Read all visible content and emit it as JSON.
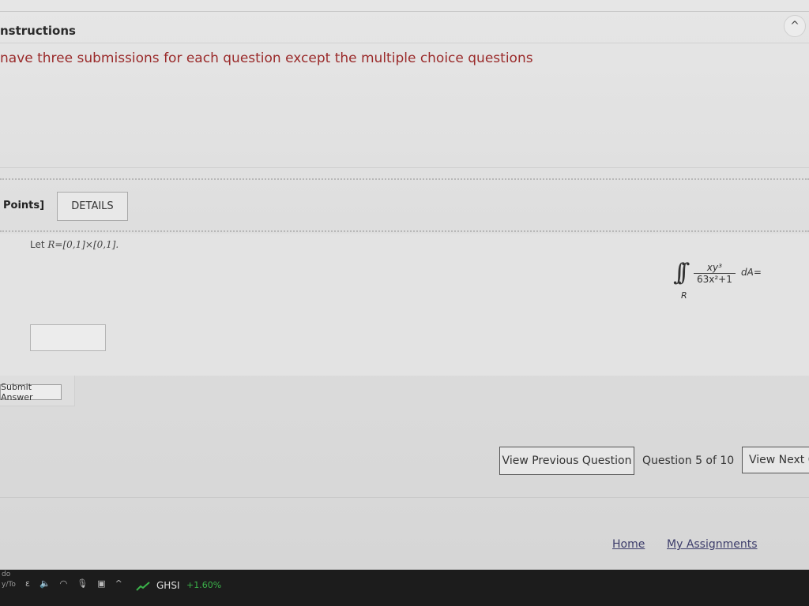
{
  "instructions": {
    "title": "nstructions",
    "text": "nave three submissions for each question except the multiple choice questions"
  },
  "header_buttons": {
    "collapse_glyph": "^"
  },
  "question": {
    "points_label": "Points]",
    "details_label": "DETAILS",
    "let_prefix": "Let ",
    "region_def": "R=[0,1]×[0,1].",
    "integral_sign": "∫∫",
    "numerator": "xy³",
    "denominator": "63x²+1",
    "differential": "dA=",
    "region_label": "R",
    "answer_value": "",
    "submit_label": "Submit Answer"
  },
  "navigation": {
    "prev_label": "View Previous Question",
    "position_label": "Question 5 of 10",
    "next_label": "View Next Q"
  },
  "footer": {
    "home_label": "Home",
    "assignments_label": "My Assignments"
  },
  "taskbar": {
    "left_line1": "do",
    "left_line2": "y/To",
    "tray_icons": [
      "ɛ",
      "speaker-icon",
      "wifi-icon",
      "mic-icon",
      "camera-icon",
      "chevron-up-icon"
    ],
    "stock_symbol": "GHSI",
    "stock_change": "+1.60%",
    "stock_change_color": "#3bb34a"
  }
}
